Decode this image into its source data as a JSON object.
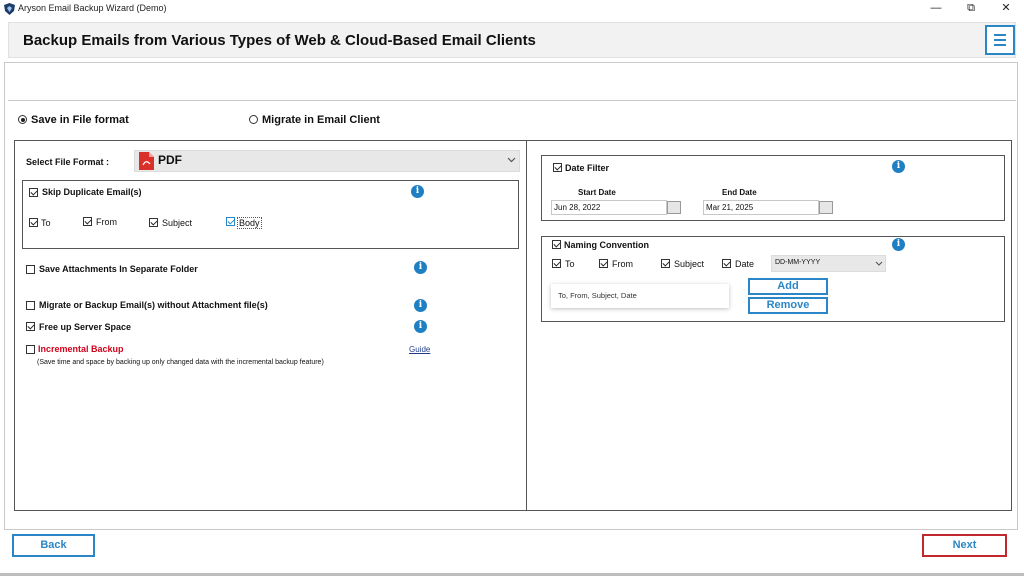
{
  "window": {
    "title": "Aryson Email Backup Wizard (Demo)",
    "minimize": "—",
    "restore": "⧉",
    "close": "✕"
  },
  "header": {
    "title": "Backup Emails from Various Types of Web & Cloud-Based Email Clients"
  },
  "mode": {
    "save_label": "Save in File format",
    "migrate_label": "Migrate in Email Client",
    "selected": "save"
  },
  "left": {
    "file_format_label": "Select File Format :",
    "file_format_value": "PDF",
    "skip_duplicate": {
      "label": "Skip Duplicate Email(s)",
      "checked": true
    },
    "dup_fields": [
      {
        "label": "To",
        "checked": true
      },
      {
        "label": "From",
        "checked": true
      },
      {
        "label": "Subject",
        "checked": true
      },
      {
        "label": "Body",
        "checked": true
      }
    ],
    "save_attachments": {
      "label": "Save Attachments In Separate Folder",
      "checked": false
    },
    "without_attachment": {
      "label": "Migrate or Backup Email(s) without Attachment file(s)",
      "checked": false
    },
    "free_server": {
      "label": "Free up Server Space",
      "checked": true
    },
    "incremental": {
      "label": "Incremental Backup",
      "checked": false,
      "guide": "Guide",
      "note": "(Save time and space by backing up only changed data with the incremental backup feature)"
    }
  },
  "right": {
    "date_filter": {
      "label": "Date Filter",
      "checked": true,
      "start_label": "Start Date",
      "start_value": "Jun 28, 2022",
      "end_label": "End Date",
      "end_value": "Mar 21, 2025"
    },
    "naming": {
      "label": "Naming Convention",
      "checked": true,
      "fields": [
        {
          "label": "To",
          "checked": true
        },
        {
          "label": "From",
          "checked": true
        },
        {
          "label": "Subject",
          "checked": true
        },
        {
          "label": "Date",
          "checked": true
        }
      ],
      "date_format": "DD-MM-YYYY",
      "preview": "To, From, Subject, Date",
      "add": "Add",
      "remove": "Remove"
    }
  },
  "footer": {
    "back": "Back",
    "next": "Next"
  },
  "colors": {
    "accent": "#2a86c6",
    "next_border": "#c0282d",
    "incremental_text": "#d0021b"
  }
}
